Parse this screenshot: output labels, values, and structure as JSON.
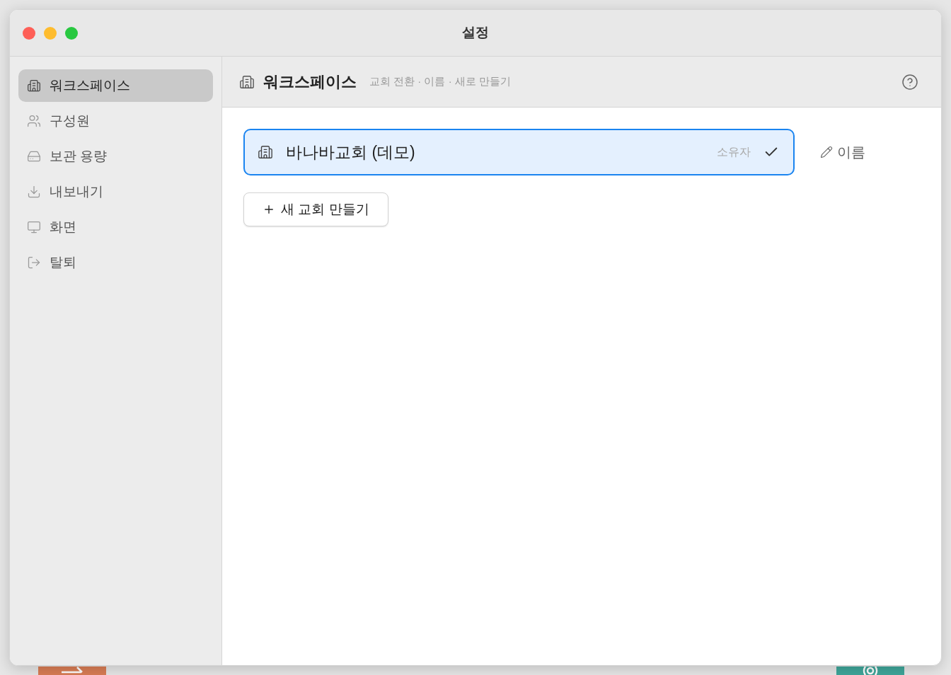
{
  "window": {
    "title": "설정"
  },
  "sidebar": {
    "items": [
      {
        "label": "워크스페이스",
        "selected": true
      },
      {
        "label": "구성원",
        "selected": false
      },
      {
        "label": "보관 용량",
        "selected": false
      },
      {
        "label": "내보내기",
        "selected": false
      },
      {
        "label": "화면",
        "selected": false
      },
      {
        "label": "탈퇴",
        "selected": false
      }
    ]
  },
  "header": {
    "title": "워크스페이스",
    "subtitle": "교회 전환 · 이름 · 새로 만들기"
  },
  "workspaces": [
    {
      "name": "바나바교회 (데모)",
      "role": "소유자",
      "selected": true
    }
  ],
  "rename_button": {
    "label": "이름"
  },
  "new_button": {
    "label": "새 교회 만들기"
  }
}
